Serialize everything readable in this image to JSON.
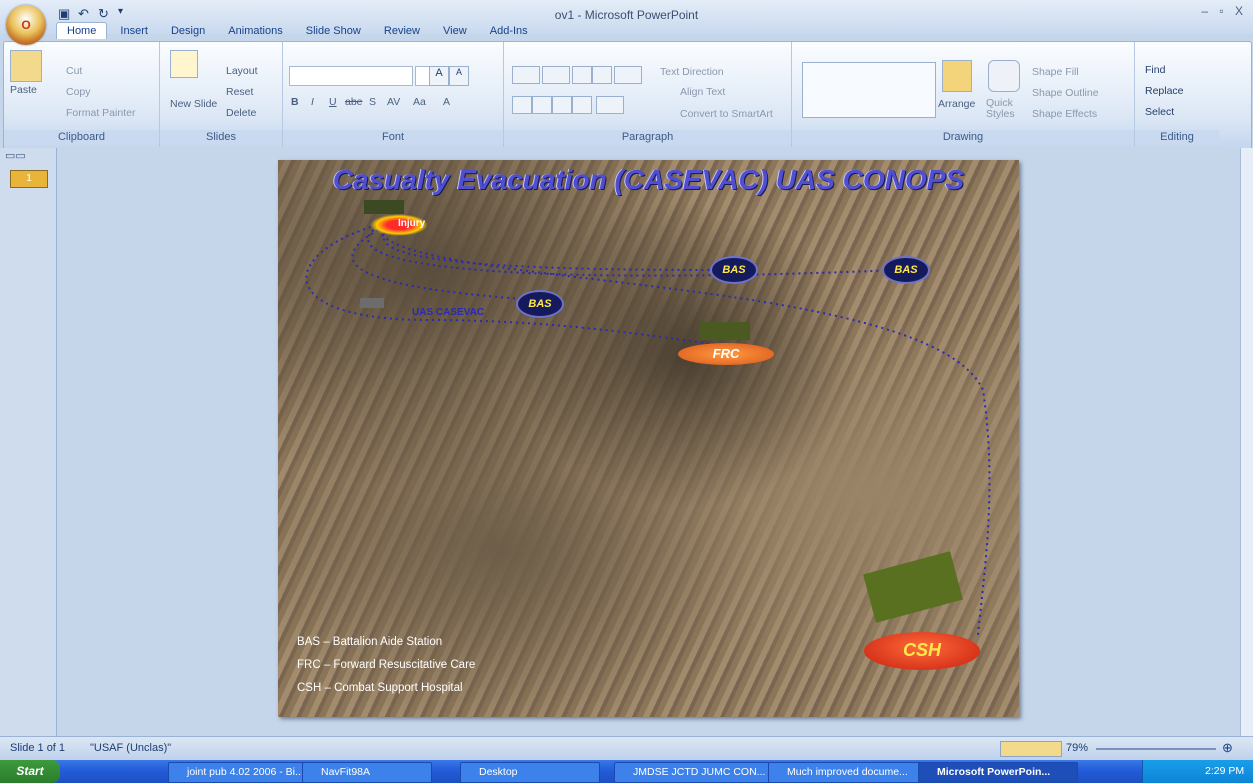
{
  "window": {
    "title": "ov1 - Microsoft PowerPoint",
    "controls": "– ▫ X"
  },
  "office_button": {
    "label": "O"
  },
  "qat": {
    "save": "▣",
    "undo": "↶",
    "redo": "↻",
    "more": "▾"
  },
  "tabs": [
    {
      "label": "Home"
    },
    {
      "label": "Insert"
    },
    {
      "label": "Design"
    },
    {
      "label": "Animations"
    },
    {
      "label": "Slide Show"
    },
    {
      "label": "Review"
    },
    {
      "label": "View"
    },
    {
      "label": "Add-Ins"
    }
  ],
  "ribbon": {
    "clipboard": {
      "label": "Clipboard",
      "paste": "Paste",
      "cut": "Cut",
      "copy": "Copy",
      "format_painter": "Format Painter"
    },
    "slides": {
      "label": "Slides",
      "new_slide": "New Slide",
      "layout": "Layout",
      "reset": "Reset",
      "delete": "Delete"
    },
    "font": {
      "label": "Font",
      "bold": "B",
      "italic": "I",
      "underline": "U",
      "strike": "abe",
      "shadow": "S",
      "spacing": "AV",
      "case": "Aa",
      "color": "A",
      "grow": "A",
      "shrink": "A"
    },
    "paragraph": {
      "label": "Paragraph",
      "text_direction": "Text Direction",
      "align_text": "Align Text",
      "smartart": "Convert to SmartArt"
    },
    "drawing": {
      "label": "Drawing",
      "arrange": "Arrange",
      "quick_styles": "Quick Styles",
      "shape_fill": "Shape Fill",
      "shape_outline": "Shape Outline",
      "shape_effects": "Shape Effects"
    },
    "editing": {
      "label": "Editing",
      "find": "Find",
      "replace": "Replace",
      "select": "Select"
    }
  },
  "slide_panel": {
    "thumb_number": "1"
  },
  "slide": {
    "title": "Casualty Evacuation (CASEVAC) UAS CONOPS",
    "bas_label": "BAS",
    "frc_label": "FRC",
    "csh_label": "CSH",
    "injury_label": "Injury",
    "uas_label": "UAS CASEVAC",
    "legend": [
      "BAS – Battalion Aide Station",
      "FRC – Forward Resuscitative Care",
      "CSH – Combat Support Hospital"
    ]
  },
  "status": {
    "slide": "Slide 1 of 1",
    "theme": "\"USAF (Unclas)\"",
    "zoom": "79%"
  },
  "taskbar": {
    "start": "Start",
    "items": [
      {
        "label": "joint pub 4.02 2006 - Bi..."
      },
      {
        "label": "NavFit98A"
      },
      {
        "label": "Desktop"
      },
      {
        "label": "JMDSE JCTD JUMC CON..."
      },
      {
        "label": "Much improved docume..."
      },
      {
        "label": "Microsoft PowerPoin..."
      }
    ],
    "time": "2:29 PM"
  }
}
